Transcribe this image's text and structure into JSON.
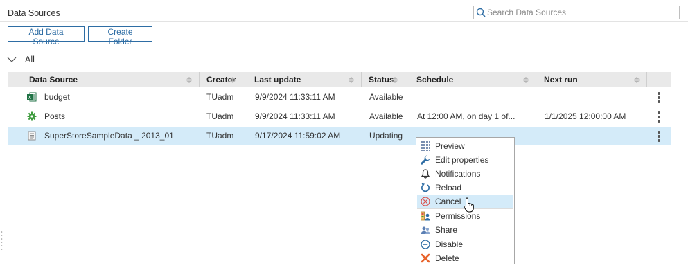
{
  "header": {
    "title": "Data Sources",
    "search_placeholder": "Search Data Sources",
    "search_value": ""
  },
  "toolbar": {
    "add_label": "Add Data Source",
    "folder_label": "Create Folder"
  },
  "tree": {
    "all_label": "All"
  },
  "columns": [
    "Data Source",
    "Creator",
    "Last update",
    "Status",
    "Schedule",
    "Next run"
  ],
  "rows": [
    {
      "icon": "excel-icon",
      "name": "budget",
      "creator": "TUadm",
      "last_update": "9/9/2024 11:33:11 AM",
      "status": "Available",
      "schedule": "",
      "next_run": ""
    },
    {
      "icon": "gear-icon",
      "name": "Posts",
      "creator": "TUadm",
      "last_update": "9/9/2024 11:33:11 AM",
      "status": "Available",
      "schedule": "At 12:00 AM, on day 1 of...",
      "next_run": "1/1/2025 12:00:00 AM"
    },
    {
      "icon": "data-file-icon",
      "name": "SuperStoreSampleData _ 2013_01",
      "creator": "TUadm",
      "last_update": "9/17/2024 11:59:02 AM",
      "status": "Updating",
      "schedule": "",
      "next_run": ""
    }
  ],
  "context_menu": {
    "items": [
      {
        "label": "Preview",
        "icon": "preview-grid-icon"
      },
      {
        "label": "Edit properties",
        "icon": "wrench-icon"
      },
      {
        "label": "Notifications",
        "icon": "bell-icon"
      },
      {
        "label": "Reload",
        "icon": "reload-icon"
      },
      {
        "label": "Cancel",
        "icon": "cancel-icon",
        "highlighted": true
      },
      {
        "label": "Permissions",
        "icon": "permissions-icon"
      },
      {
        "label": "Share",
        "icon": "share-icon"
      },
      {
        "label": "Disable",
        "icon": "disable-icon"
      },
      {
        "label": "Delete",
        "icon": "delete-icon"
      }
    ]
  },
  "colors": {
    "accent": "#2e6da4",
    "selected_row": "#d4ebf9",
    "header_bg": "#e9e9e9",
    "cancel_red": "#d9534f",
    "delete_orange": "#e8632b"
  }
}
